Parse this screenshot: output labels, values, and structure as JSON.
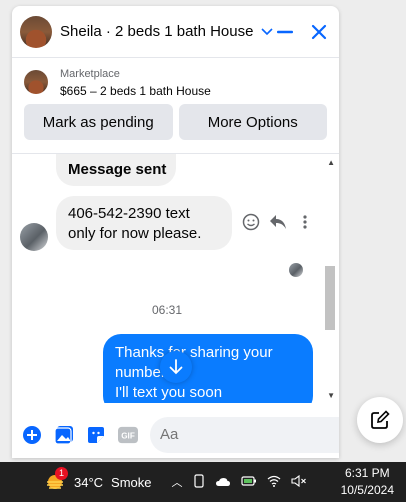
{
  "header": {
    "title": "Sheila · 2 beds 1 bath House"
  },
  "marketplace": {
    "label": "Marketplace",
    "title": "$665 – 2 beds 1 bath House",
    "pending_label": "Mark as pending",
    "more_label": "More Options"
  },
  "messages": {
    "sent_partial": "Message sent",
    "incoming": [
      "406-542-2390 text",
      "only for now please."
    ],
    "time": "06:31",
    "outgoing": [
      "Thanks for sharing your",
      "number",
      "I'll text you soon"
    ]
  },
  "composer": {
    "placeholder": "Aa",
    "gif_label": "GIF"
  },
  "taskbar": {
    "badge": "1",
    "temp": "34°C",
    "weather": "Smoke",
    "time": "6:31 PM",
    "date": "10/5/2024"
  },
  "colors": {
    "accent": "#0866ff",
    "bubble_out": "#0a7cff",
    "bubble_in": "#f0f0f0"
  }
}
